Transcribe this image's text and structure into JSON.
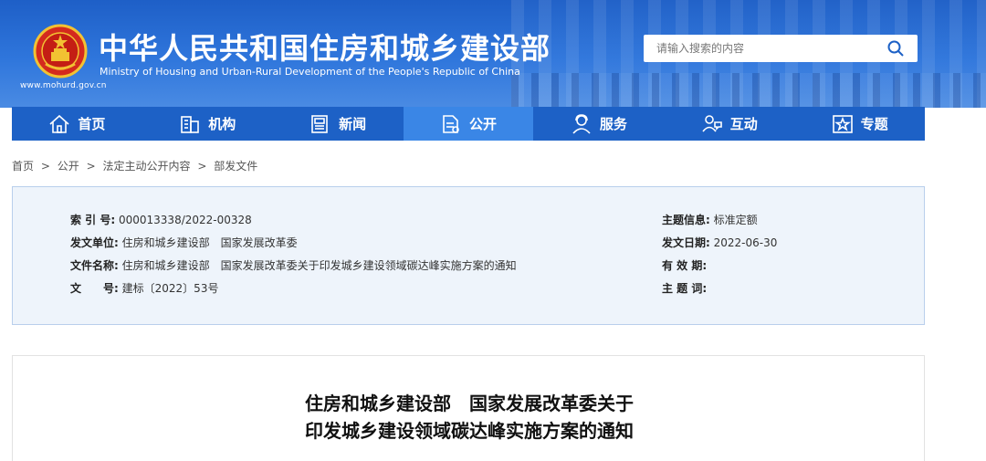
{
  "header": {
    "title": "中华人民共和国住房和城乡建设部",
    "subtitle": "Ministry of Housing and Urban-Rural Development of the People's Republic of China",
    "site_url": "www.mohurd.gov.cn",
    "search_placeholder": "请输入搜索的内容",
    "colors": {
      "banner": "#2f76dc",
      "nav": "#1d61c6",
      "nav_active": "#3a86e6"
    }
  },
  "nav": {
    "items": [
      {
        "label": "首页",
        "icon": "home-icon"
      },
      {
        "label": "机构",
        "icon": "building-icon"
      },
      {
        "label": "新闻",
        "icon": "newspaper-icon"
      },
      {
        "label": "公开",
        "icon": "document-icon",
        "active": true
      },
      {
        "label": "服务",
        "icon": "user-service-icon"
      },
      {
        "label": "互动",
        "icon": "interaction-icon"
      },
      {
        "label": "专题",
        "icon": "star-icon"
      }
    ]
  },
  "breadcrumb": {
    "items": [
      "首页",
      "公开",
      "法定主动公开内容",
      "部发文件"
    ],
    "separator": ">"
  },
  "info": {
    "index_label": "索 引 号:",
    "index_value": "000013338/2022-00328",
    "unit_label": "发文单位:",
    "unit_value": "住房和城乡建设部　国家发展改革委",
    "name_label": "文件名称:",
    "name_value": "住房和城乡建设部　国家发展改革委关于印发城乡建设领域碳达峰实施方案的通知",
    "number_label": "文　　号:",
    "number_value": "建标〔2022〕53号",
    "topic_label": "主题信息:",
    "topic_value": "标准定额",
    "date_label": "发文日期:",
    "date_value": "2022-06-30",
    "validity_label": "有 效 期:",
    "validity_value": "",
    "keywords_label": "主 题 词:",
    "keywords_value": ""
  },
  "article": {
    "title_line1": "住房和城乡建设部　国家发展改革委关于",
    "title_line2": "印发城乡建设领域碳达峰实施方案的通知"
  }
}
